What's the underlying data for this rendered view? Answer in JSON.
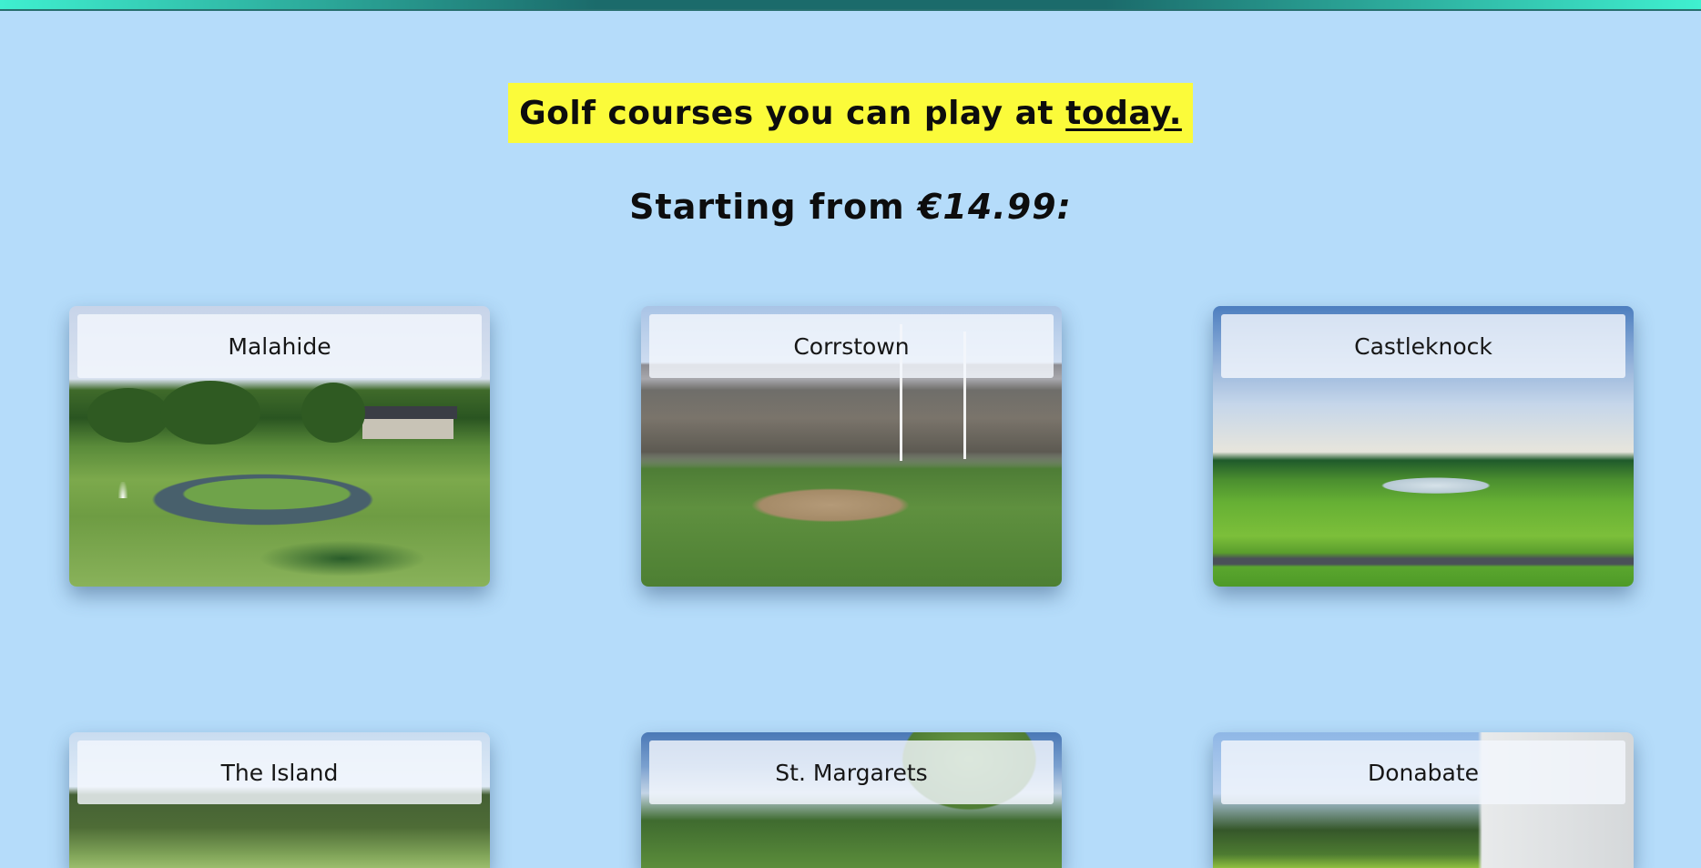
{
  "headline": {
    "text": "Golf courses you can play at",
    "underlined": "today."
  },
  "subhead": {
    "text": "Starting from",
    "price": "€14.99:"
  },
  "courses": [
    {
      "name": "Malahide"
    },
    {
      "name": "Corrstown"
    },
    {
      "name": "Castleknock"
    },
    {
      "name": "The Island"
    },
    {
      "name": "St. Margarets"
    },
    {
      "name": "Donabate"
    }
  ],
  "colors": {
    "background": "#b5dcfa",
    "headline_highlight": "#fbfb3a",
    "top_bar": "#1b6b6b"
  }
}
